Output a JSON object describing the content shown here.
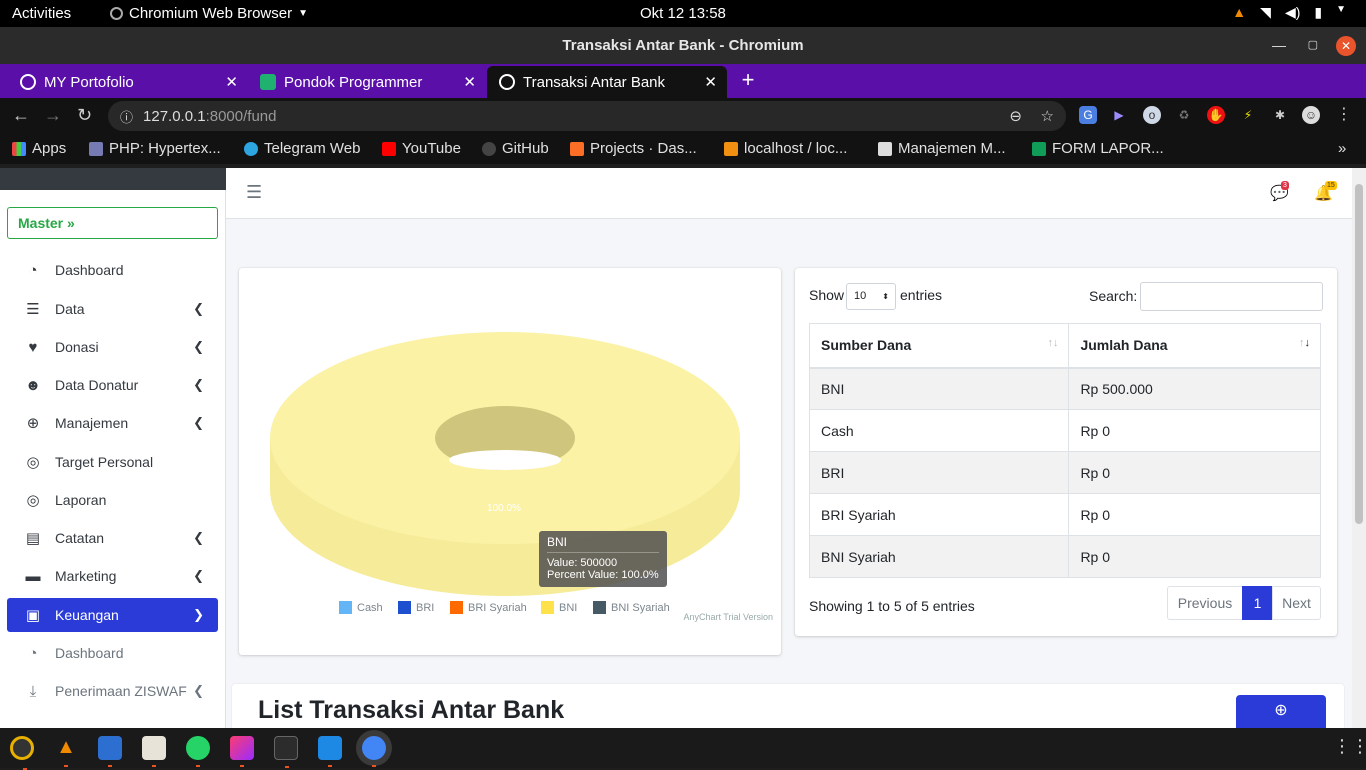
{
  "os": {
    "activities": "Activities",
    "app_name": "Chromium Web Browser",
    "clock": "Okt 12  13:58"
  },
  "window": {
    "title": "Transaksi Antar Bank - Chromium"
  },
  "tabs": [
    {
      "title": "MY Portofolio"
    },
    {
      "title": "Pondok Programmer"
    },
    {
      "title": "Transaksi Antar Bank"
    }
  ],
  "address": {
    "host": "127.0.0.1",
    "path": ":8000/fund"
  },
  "bookmarks": [
    {
      "label": "Apps"
    },
    {
      "label": "PHP: Hypertex..."
    },
    {
      "label": "Telegram Web"
    },
    {
      "label": "YouTube"
    },
    {
      "label": "GitHub"
    },
    {
      "label": "Projects · Das..."
    },
    {
      "label": "localhost / loc..."
    },
    {
      "label": "Manajemen M..."
    },
    {
      "label": "FORM LAPOR..."
    }
  ],
  "navbar": {
    "messages_count": "3",
    "notifications_count": "15"
  },
  "sidebar": {
    "master_label": "Master",
    "items": [
      {
        "label": "Dashboard"
      },
      {
        "label": "Data"
      },
      {
        "label": "Donasi"
      },
      {
        "label": "Data Donatur"
      },
      {
        "label": "Manajemen"
      },
      {
        "label": "Target Personal"
      },
      {
        "label": "Laporan"
      },
      {
        "label": "Catatan"
      },
      {
        "label": "Marketing"
      },
      {
        "label": "Keuangan"
      },
      {
        "label": "Dashboard"
      },
      {
        "label": "Penerimaan ZISWAF"
      }
    ]
  },
  "chart_data": {
    "type": "pie",
    "categories": [
      "Cash",
      "BRI",
      "BRI Syariah",
      "BNI",
      "BNI Syariah"
    ],
    "values": [
      0,
      0,
      0,
      500000,
      0
    ],
    "colors": [
      "#64b5f6",
      "#1e4fcf",
      "#ff6a00",
      "#ffe14a",
      "#455a64"
    ],
    "slice_label": "100.0%",
    "tooltip": {
      "title": "BNI",
      "value_text": "Value: 500000",
      "percent_text": "Percent Value: 100.0%"
    },
    "credit": "AnyChart Trial Version",
    "legend_position": "bottom"
  },
  "table": {
    "show_label": "Show",
    "entries_label": "entries",
    "page_size": "10",
    "search_label": "Search:",
    "headers": [
      "Sumber Dana",
      "Jumlah Dana"
    ],
    "rows": [
      [
        "BNI",
        "Rp 500.000"
      ],
      [
        "Cash",
        "Rp 0"
      ],
      [
        "BRI",
        "Rp 0"
      ],
      [
        "BRI Syariah",
        "Rp 0"
      ],
      [
        "BNI Syariah",
        "Rp 0"
      ]
    ],
    "info": "Showing 1 to 5 of 5 entries",
    "prev": "Previous",
    "page": "1",
    "next": "Next"
  },
  "list": {
    "title": "List Transaksi Antar Bank"
  }
}
